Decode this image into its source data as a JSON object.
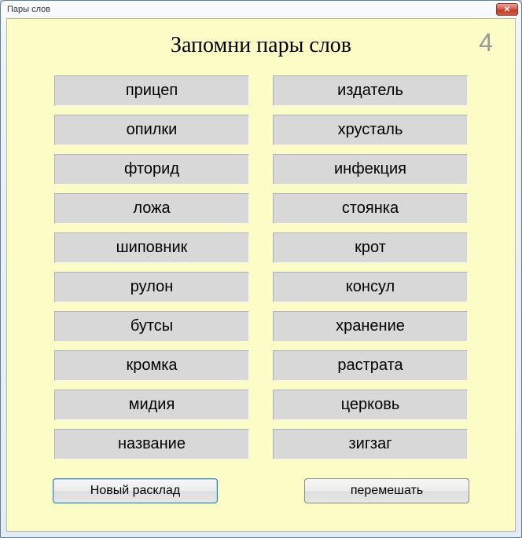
{
  "window": {
    "title": "Пары слов"
  },
  "header": {
    "heading": "Запомни пары слов",
    "counter": "4"
  },
  "pairs": {
    "left": [
      "прицеп",
      "опилки",
      "фторид",
      "ложа",
      "шиповник",
      "рулон",
      "бутсы",
      "кромка",
      "мидия",
      "название"
    ],
    "right": [
      "издатель",
      "хрусталь",
      "инфекция",
      "стоянка",
      "крот",
      "консул",
      "хранение",
      "растрата",
      "церковь",
      "зигзаг"
    ]
  },
  "buttons": {
    "new_deal": "Новый расклад",
    "shuffle": "перемешать"
  }
}
